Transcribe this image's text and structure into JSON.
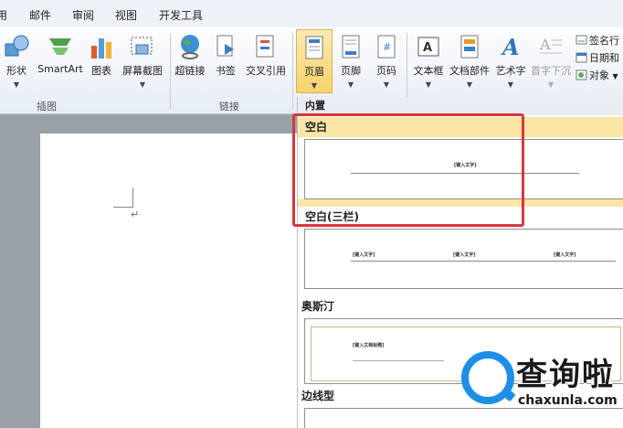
{
  "menu": {
    "tabs": [
      "用",
      "邮件",
      "审阅",
      "视图",
      "开发工具"
    ]
  },
  "ribbon": {
    "buttons": {
      "shape": "形状",
      "smartart": "SmartArt",
      "chart": "图表",
      "screenshot": "屏幕截图",
      "hyperlink": "超链接",
      "bookmark": "书签",
      "crossref": "交叉引用",
      "header": "页眉",
      "footer": "页脚",
      "pagenum": "页码",
      "textbox": "文本框",
      "quickparts": "文档部件",
      "wordart": "艺术字",
      "dropcap": "首字下沉"
    },
    "small_buttons": {
      "signature": "签名行",
      "datetime": "日期和",
      "object": "对象"
    },
    "groups": {
      "illustrations": "插图",
      "links": "链接"
    }
  },
  "document": {
    "paragraph_mark": "↵"
  },
  "gallery": {
    "section_builtin": "内置",
    "items": [
      {
        "title": "空白",
        "placeholder": "[键入文字]"
      },
      {
        "title": "空白(三栏)",
        "placeholders": [
          "[键入文字]",
          "[键入文字]",
          "[键入文字]"
        ]
      },
      {
        "title": "奥斯汀",
        "placeholder": "[键入文档标题]"
      },
      {
        "title": "边线型"
      }
    ]
  },
  "watermark": {
    "brand": "查询啦",
    "url": "chaxunla.com"
  },
  "colors": {
    "highlight": "#d9363b",
    "hover": "#fbe6a6",
    "accent": "#1e8fe6"
  }
}
